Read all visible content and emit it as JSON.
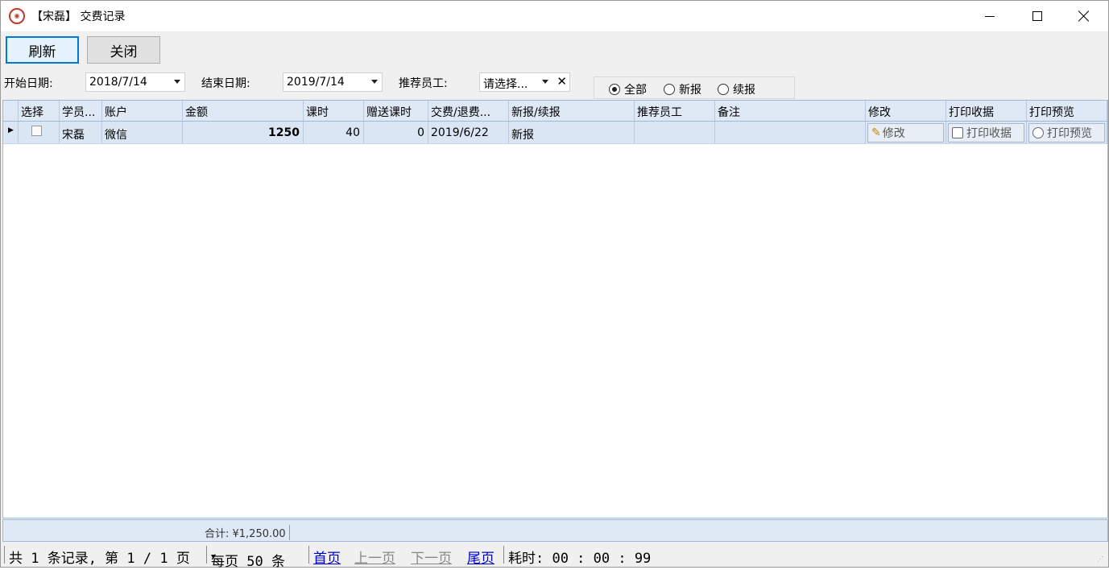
{
  "window": {
    "title": "【宋磊】 交费记录",
    "app_icon": "logo-icon"
  },
  "toolbar": {
    "refresh_label": "刷新",
    "close_label": "关闭"
  },
  "filters": {
    "start_label": "开始日期:",
    "start_value": "2018/7/14",
    "end_label": "结束日期:",
    "end_value": "2019/7/14",
    "staff_label": "推荐员工:",
    "staff_placeholder": "请选择...",
    "radio_all": "全部",
    "radio_new": "新报",
    "radio_renew": "续报",
    "radio_selected": "全部"
  },
  "table": {
    "headers": [
      "选择",
      "学员...",
      "账户",
      "金额",
      "课时",
      "赠送课时",
      "交费/退费...",
      "新报/续报",
      "推荐员工",
      "备注",
      "修改",
      "打印收据",
      "打印预览"
    ],
    "rows": [
      {
        "student": "宋磊",
        "account": "微信",
        "amount": "1250",
        "hours": "40",
        "bonus": "0",
        "date": "2019/6/22",
        "type": "新报",
        "staff": "",
        "note": "",
        "edit": "修改",
        "print": "打印收据",
        "preview": "打印预览"
      }
    ]
  },
  "summary": {
    "total": "合计: ¥1,250.00"
  },
  "pager": {
    "info": "共 1 条记录, 第 1 / 1 页",
    "per_page": "每页 50 条",
    "first": "首页",
    "prev": "上一页",
    "next": "下一页",
    "last": "尾页",
    "elapsed": "耗时: 00 : 00 : 99"
  }
}
